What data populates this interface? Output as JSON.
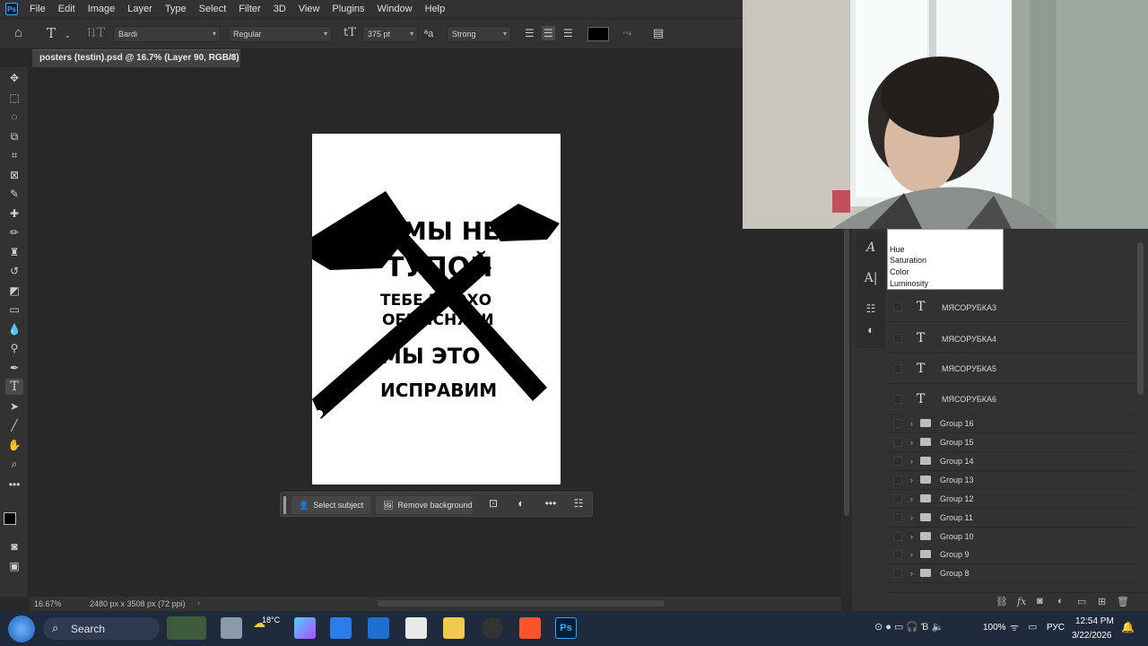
{
  "menubar": {
    "items": [
      "File",
      "Edit",
      "Image",
      "Layer",
      "Type",
      "Select",
      "Filter",
      "3D",
      "View",
      "Plugins",
      "Window",
      "Help"
    ]
  },
  "options": {
    "font_family": "Bardi",
    "font_style": "Regular",
    "font_size": "375 pt",
    "antialias": "Strong",
    "color_swatch": "#000000"
  },
  "document": {
    "tab_title": "posters (testin).psd @ 16.7% (Layer 90, RGB/8) *"
  },
  "poster": {
    "lines": [
      "МЫ НЕ",
      "ТУПОЙ",
      "ТЕБЕ ПЛОХО",
      "ОБЪЯСНЯЛИ",
      "МЫ ЭТО",
      "ИСПРАВИМ"
    ]
  },
  "context_bar": {
    "select_subject": "Select subject",
    "remove_background": "Remove background"
  },
  "statusbar": {
    "zoom": "16.67%",
    "doc_info": "2480 px x 3508 px (72 ppi)"
  },
  "blend_dropdown": {
    "options": [
      "Hue",
      "Saturation",
      "Color",
      "Luminosity"
    ]
  },
  "layers": {
    "text_layers": [
      "МЯСОРУБКА3",
      "МЯСОРУБКА4",
      "МЯСОРУБКА5",
      "МЯСОРУБКА6"
    ],
    "groups": [
      "Group 16",
      "Group 15",
      "Group 14",
      "Group 13",
      "Group 12",
      "Group 11",
      "Group 10",
      "Group 9",
      "Group 8"
    ]
  },
  "taskbar": {
    "search_label": "Search",
    "weather": "18°C",
    "battery": "100%",
    "language": "РУС",
    "time": "12:54 PM",
    "date": "3/22/2026"
  }
}
